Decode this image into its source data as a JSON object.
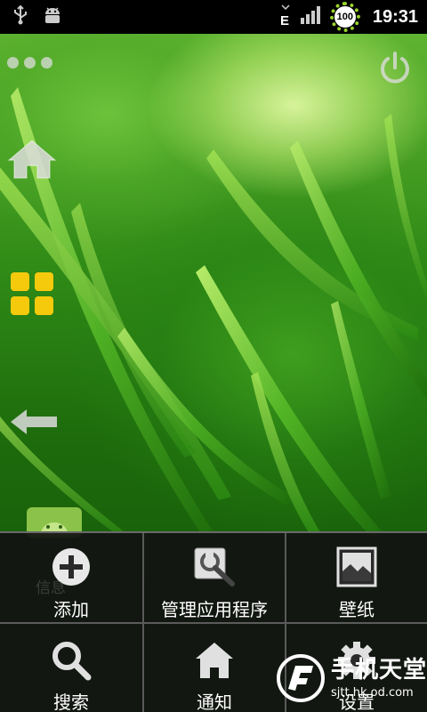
{
  "status_bar": {
    "icons": [
      "usb-icon",
      "android-debug-icon",
      "network-e-icon",
      "signal-icon"
    ],
    "network_type": "E",
    "battery_level": "100",
    "time": "19:31"
  },
  "launcher": {
    "left_icons": [
      "home-icon",
      "all-apps-icon",
      "back-arrow-icon"
    ],
    "top_icons": [
      "more-dots-icon",
      "power-icon"
    ],
    "background_label": "信息"
  },
  "menu": {
    "rows": [
      [
        {
          "label": "添加",
          "icon": "add-icon"
        },
        {
          "label": "管理应用程序",
          "icon": "manage-apps-icon"
        },
        {
          "label": "壁纸",
          "icon": "wallpaper-icon"
        }
      ],
      [
        {
          "label": "搜索",
          "icon": "search-icon"
        },
        {
          "label": "通知",
          "icon": "notification-home-icon"
        },
        {
          "label": "设置",
          "icon": "settings-icon"
        }
      ]
    ]
  },
  "watermark": {
    "main": "手机天堂",
    "sub": "sjtt.hk    od.com"
  },
  "colors": {
    "grid_yellow": "#f5c90c",
    "battery_ring": "#9bd42a",
    "menu_bg": "#121212"
  }
}
